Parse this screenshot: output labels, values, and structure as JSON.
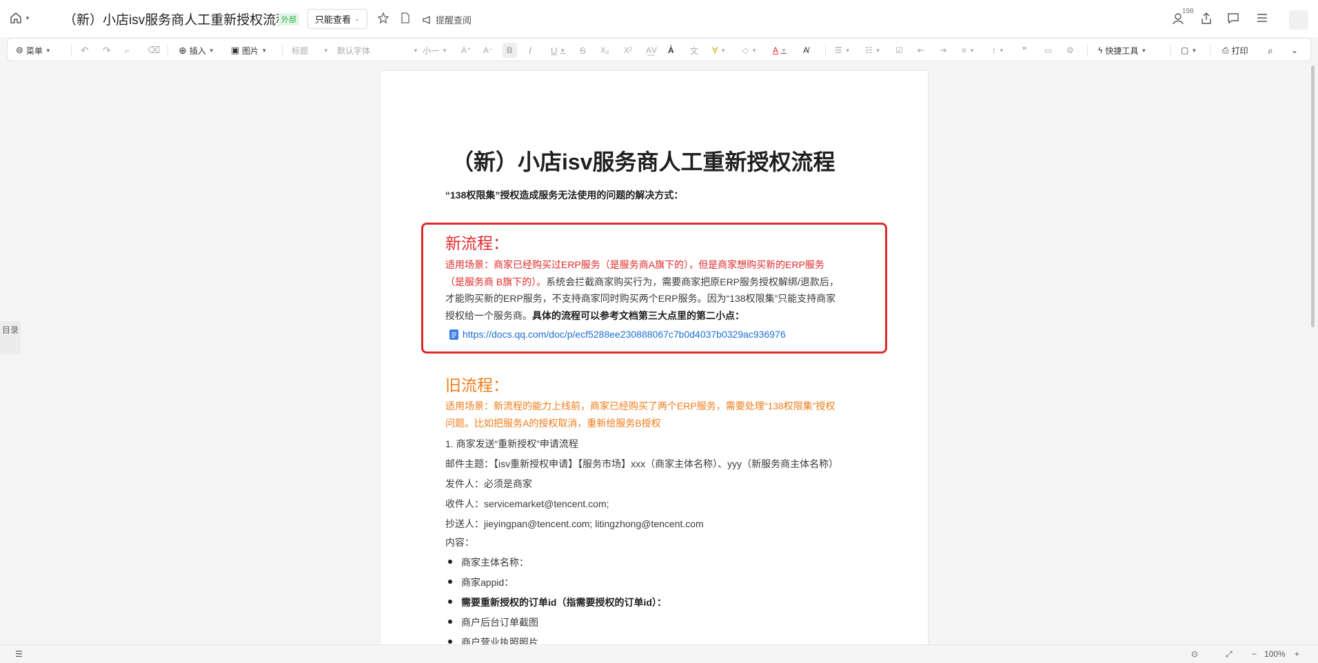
{
  "titlebar": {
    "doc_title": "（新）小店isv服务商人工重新授权流程",
    "external_badge": "外部",
    "permission": "只能查看",
    "remind_label": "提醒查阅",
    "collaborators_count": "198"
  },
  "toolbar": {
    "menu": "菜单",
    "insert": "插入",
    "image": "图片",
    "heading": "标题",
    "font": "默认字体",
    "size": "小一",
    "quick_tools": "快捷工具",
    "print": "打印"
  },
  "document": {
    "title": "（新）小店isv服务商人工重新授权流程",
    "intro": "“138权限集”授权造成服务无法使用的问题的解决方式：",
    "new_flow": {
      "heading": "新流程：",
      "line1": "适用场景：商家已经购买过ERP服务（是服务商A旗下的），但是商家想购买新的ERP服务",
      "line2_red": "（是服务商 B旗下的）。",
      "line2_rest": "系统会拦截商家购买行为，需要商家把原ERP服务授权解绑/退款后，",
      "line3": "才能购买新的ERP服务，不支持商家同时购买两个ERP服务。因为“138权限集”只能支持商家",
      "line4_plain": "授权给一个服务商。",
      "line4_bold": "具体的流程可以参考文档第三大点里的第二小点：",
      "link": "https://docs.qq.com/doc/p/ecf5288ee230888067c7b0d4037b0329ac936976"
    },
    "old_flow": {
      "heading": "旧流程：",
      "line1": "适用场景：新流程的能力上线前，商家已经购买了两个ERP服务，需要处理“138权限集”授权",
      "line2": "问题。比如把服务A的授权取消，重新给服务B授权",
      "step1": "1.  商家发送“重新授权”申请流程",
      "subject": "邮件主题：【isv重新授权申请】【服务市场】xxx（商家主体名称）、yyy（新服务商主体名称）",
      "sender": "发件人：必须是商家",
      "receiver": "收件人：servicemarket@tencent.com;",
      "cc": "抄送人：jieyingpan@tencent.com; litingzhong@tencent.com",
      "content": "内容：",
      "bullets": [
        "商家主体名称：",
        "商家appid：",
        "需要重新授权的订单id（指需要授权的订单id）：",
        "商户后台订单截图",
        "商户营业执照照片"
      ]
    }
  },
  "sidebar": {
    "toc": "目录"
  },
  "statusbar": {
    "zoom": "100%"
  }
}
